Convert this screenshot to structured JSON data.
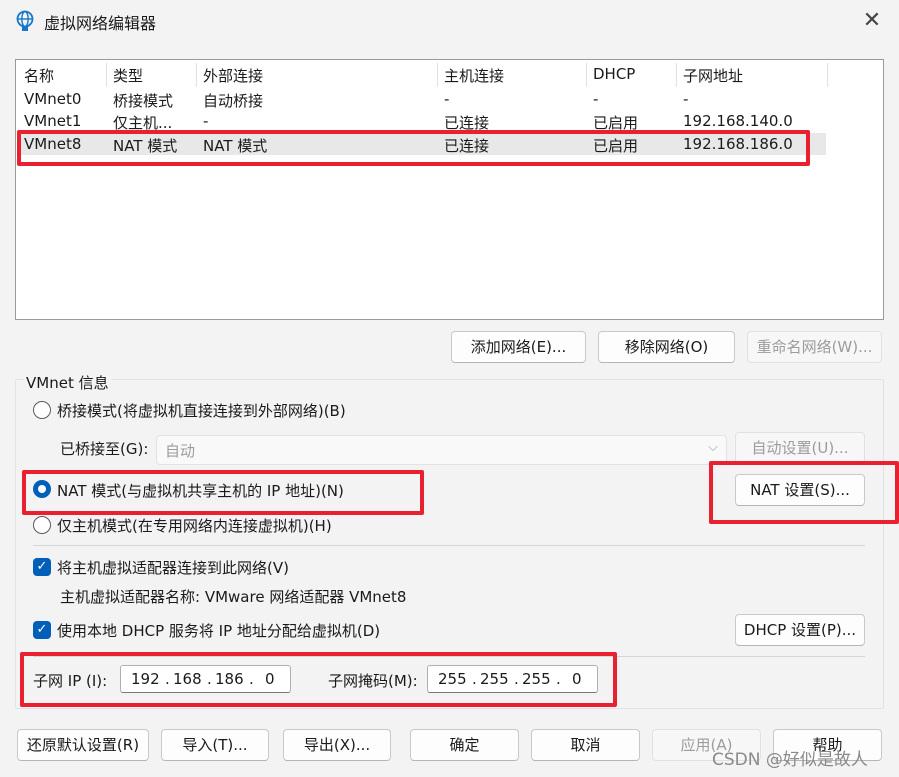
{
  "window": {
    "title": "虚拟网络编辑器",
    "close_glyph": "✕"
  },
  "list": {
    "headers": [
      "名称",
      "类型",
      "外部连接",
      "主机连接",
      "DHCP",
      "子网地址"
    ],
    "rows": [
      {
        "name": "VMnet0",
        "type": "桥接模式",
        "ext": "自动桥接",
        "host": "-",
        "dhcp": "-",
        "subnet": "-"
      },
      {
        "name": "VMnet1",
        "type": "仅主机...",
        "ext": "-",
        "host": "已连接",
        "dhcp": "已启用",
        "subnet": "192.168.140.0"
      },
      {
        "name": "VMnet8",
        "type": "NAT 模式",
        "ext": "NAT 模式",
        "host": "已连接",
        "dhcp": "已启用",
        "subnet": "192.168.186.0"
      }
    ],
    "selected_row": 2
  },
  "list_buttons": {
    "add": "添加网络(E)...",
    "remove": "移除网络(O)",
    "rename": "重命名网络(W)..."
  },
  "vmnet_info": {
    "group_label": "VMnet 信息",
    "bridged_label": "桥接模式(将虚拟机直接连接到外部网络)(B)",
    "bridged_to_label": "已桥接至(G):",
    "bridged_to_value": "自动",
    "auto_settings": "自动设置(U)...",
    "nat_label": "NAT 模式(与虚拟机共享主机的 IP 地址)(N)",
    "nat_settings": "NAT 设置(S)...",
    "hostonly_label": "仅主机模式(在专用网络内连接虚拟机)(H)",
    "selected_mode": "nat",
    "connect_adapter_label": "将主机虚拟适配器连接到此网络(V)",
    "connect_adapter_checked": true,
    "adapter_name_label": "主机虚拟适配器名称: VMware 网络适配器 VMnet8",
    "dhcp_label": "使用本地 DHCP 服务将 IP 地址分配给虚拟机(D)",
    "dhcp_checked": true,
    "dhcp_settings": "DHCP 设置(P)...",
    "subnet_ip_label": "子网 IP (I):",
    "subnet_ip": [
      "192",
      "168",
      "186",
      "0"
    ],
    "subnet_mask_label": "子网掩码(M):",
    "subnet_mask": [
      "255",
      "255",
      "255",
      "0"
    ]
  },
  "footer_buttons": {
    "restore": "还原默认设置(R)",
    "import": "导入(T)...",
    "export": "导出(X)...",
    "ok": "确定",
    "cancel": "取消",
    "apply": "应用(A)",
    "help": "帮助"
  },
  "watermark": "CSDN @好似是故人",
  "colors": {
    "accent": "#005fb8",
    "highlight_box": "#e8202f"
  }
}
